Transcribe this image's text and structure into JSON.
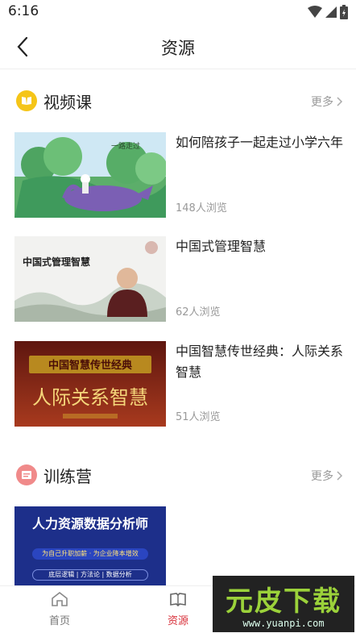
{
  "status_bar": {
    "time": "6:16"
  },
  "header": {
    "title": "资源"
  },
  "video_section": {
    "title": "视频课",
    "more_label": "更多",
    "items": [
      {
        "title": "如何陪孩子一起走过小学六年",
        "views": "148人浏览"
      },
      {
        "title": "中国式管理智慧",
        "views": "62人浏览"
      },
      {
        "title": "中国智慧传世经典：人际关系智慧",
        "views": "51人浏览"
      }
    ]
  },
  "training_section": {
    "title": "训练营",
    "more_label": "更多",
    "items": [
      {
        "thumb_text": "人力资源数据分析师",
        "thumb_sub": "为自己升职加薪 · 为企业降本增效",
        "thumb_tags": "底层逻辑 | 方法论 | 数据分析"
      }
    ]
  },
  "thumbnails": {
    "video2_title": "中国式管理智慧",
    "video3_top": "中国智慧传世经典",
    "video3_main": "人际关系智慧"
  },
  "tab_bar": {
    "tabs": [
      {
        "label": "首页",
        "icon": "home-icon",
        "active": false
      },
      {
        "label": "资源",
        "icon": "book-icon",
        "active": true
      }
    ]
  },
  "watermark": {
    "main": "元皮下载",
    "sub": "www.yuanpi.com"
  },
  "colors": {
    "accent": "#d8303a",
    "video_icon": "#f5c518",
    "training_icon": "#f08a8a"
  }
}
